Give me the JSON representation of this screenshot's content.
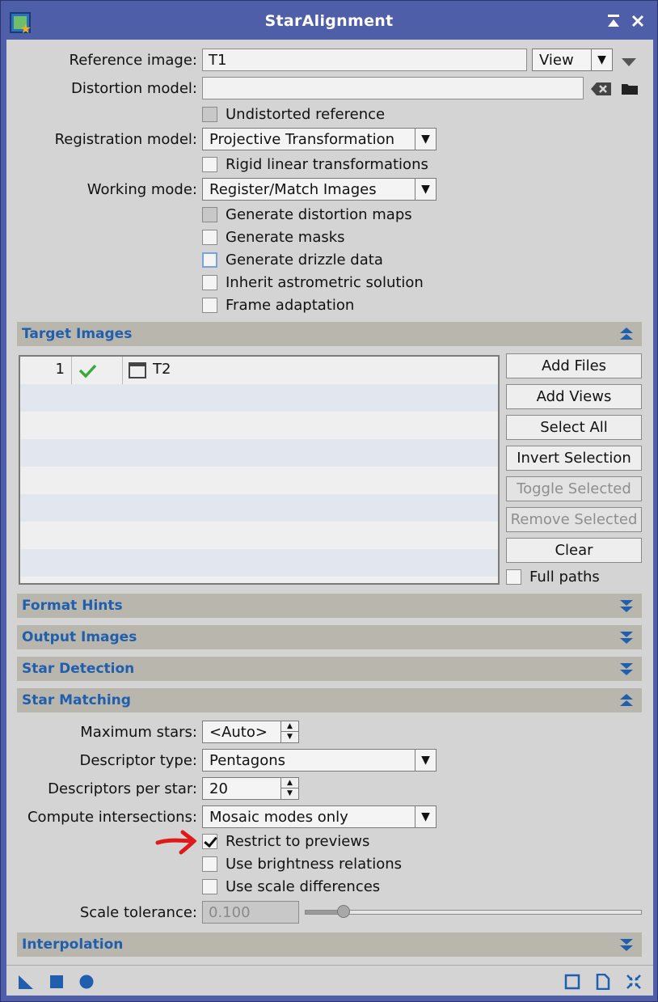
{
  "window": {
    "title": "StarAlignment"
  },
  "reference": {
    "label": "Reference image:",
    "value": "T1",
    "view_label": "View"
  },
  "distortion": {
    "label": "Distortion model:",
    "value": ""
  },
  "undistorted_reference": {
    "label": "Undistorted reference",
    "checked": false
  },
  "registration": {
    "label": "Registration model:",
    "value": "Projective Transformation"
  },
  "rigid": {
    "label": "Rigid linear transformations",
    "checked": false
  },
  "working_mode": {
    "label": "Working mode:",
    "value": "Register/Match Images"
  },
  "options": [
    {
      "label": "Generate distortion maps",
      "checked": false
    },
    {
      "label": "Generate masks",
      "checked": false
    },
    {
      "label": "Generate drizzle data",
      "checked": false
    },
    {
      "label": "Inherit astrometric solution",
      "checked": false
    },
    {
      "label": "Frame adaptation",
      "checked": false
    }
  ],
  "sections": {
    "target_images": "Target Images",
    "format_hints": "Format Hints",
    "output_images": "Output Images",
    "star_detection": "Star Detection",
    "star_matching": "Star Matching",
    "interpolation": "Interpolation"
  },
  "targets": [
    {
      "index": "1",
      "enabled": true,
      "name": "T2"
    }
  ],
  "target_buttons": {
    "add_files": "Add Files",
    "add_views": "Add Views",
    "select_all": "Select All",
    "invert_selection": "Invert Selection",
    "toggle_selected": "Toggle Selected",
    "remove_selected": "Remove Selected",
    "clear": "Clear",
    "full_paths": "Full paths"
  },
  "star_matching": {
    "max_stars_label": "Maximum stars:",
    "max_stars_value": "<Auto>",
    "descriptor_type_label": "Descriptor type:",
    "descriptor_type_value": "Pentagons",
    "descriptors_per_star_label": "Descriptors per star:",
    "descriptors_per_star_value": "20",
    "compute_intersections_label": "Compute intersections:",
    "compute_intersections_value": "Mosaic modes only",
    "restrict_to_previews": "Restrict to previews",
    "use_brightness_relations": "Use brightness relations",
    "use_scale_differences": "Use scale differences",
    "scale_tolerance_label": "Scale tolerance:",
    "scale_tolerance_value": "0.100"
  },
  "colors": {
    "title_bar": "#4f5ea8",
    "section_title": "#1f5fae",
    "annotation_arrow": "#e01a1a"
  }
}
